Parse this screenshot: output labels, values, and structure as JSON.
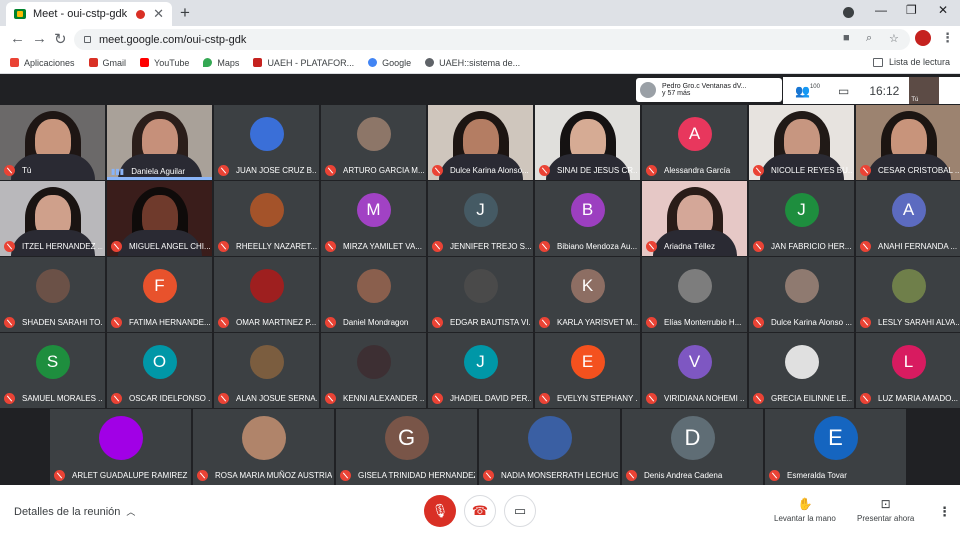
{
  "browser": {
    "tab_title": "Meet - oui-cstp-gdk",
    "tab_close": "✕",
    "new_tab": "+",
    "url": "meet.google.com/oui-cstp-gdk",
    "window_controls": [
      "—",
      "❐",
      "✕"
    ],
    "bookmarks": [
      {
        "label": "Aplicaciones",
        "color": "#ea4335"
      },
      {
        "label": "Gmail",
        "color": "#d93025"
      },
      {
        "label": "YouTube",
        "color": "#ff0000"
      },
      {
        "label": "Maps",
        "color": "#34a853"
      },
      {
        "label": "UAEH - PLATAFOR...",
        "color": "#c5221f"
      },
      {
        "label": "Google",
        "color": "#4285f4"
      },
      {
        "label": "UAEH::sistema de...",
        "color": "#5f6368"
      }
    ],
    "reading_list": "Lista de lectura"
  },
  "meet": {
    "presenter_line1": "Pedro Gro.c Ventanas dV...",
    "presenter_line2": "y 57 más",
    "people_count": "100",
    "clock": "16:12",
    "self_label": "Tú",
    "meeting_details": "Detalles de la reunión",
    "raise_hand": "Levantar la mano",
    "present_now": "Presentar ahora",
    "accent_color": "#8ab4f8",
    "mute_color": "#ea4335"
  },
  "participants": [
    {
      "name": "Tú",
      "kind": "video",
      "face": "#c9967d",
      "hair": "#1e1614",
      "bg": "#6b6969"
    },
    {
      "name": "Daniela Aguilar",
      "kind": "video",
      "face": "#c6907a",
      "hair": "#2b1e1a",
      "bg": "#a9a199",
      "speaking": true
    },
    {
      "name": "JUAN JOSE CRUZ B...",
      "kind": "photo",
      "color": "#3a6fd8"
    },
    {
      "name": "ARTURO GARCIA M...",
      "kind": "photo",
      "color": "#8d7668"
    },
    {
      "name": "Dulce Karina Alonso...",
      "kind": "video",
      "face": "#b47d63",
      "hair": "#1d1512",
      "bg": "#cfc6bd"
    },
    {
      "name": "SINAI DE JESUS CR...",
      "kind": "video",
      "face": "#d6ab94",
      "hair": "#151212",
      "bg": "#e0dfdc"
    },
    {
      "name": "Alessandra García",
      "kind": "letter",
      "letter": "A",
      "color": "#e8375d"
    },
    {
      "name": "NICOLLE REYES BU...",
      "kind": "video",
      "face": "#c79680",
      "hair": "#211a17",
      "bg": "#e7e3df"
    },
    {
      "name": "CESAR CRISTOBAL ...",
      "kind": "video",
      "face": "#c8947b",
      "hair": "#1c1512",
      "bg": "#9c8370"
    },
    {
      "name": "ITZEL HERNANDEZ ...",
      "kind": "video",
      "face": "#cfa08b",
      "hair": "#1a1412",
      "bg": "#b9b8bb"
    },
    {
      "name": "MIGUEL ANGEL CHI...",
      "kind": "video",
      "face": "#6f3a2c",
      "hair": "#0f0b0a",
      "bg": "#3a1d1b"
    },
    {
      "name": "RHEELLY NAZARET...",
      "kind": "photo",
      "color": "#a4532a"
    },
    {
      "name": "MIRZA YAMILET VA...",
      "kind": "letter",
      "letter": "M",
      "color": "#a142c4"
    },
    {
      "name": "JENNIFER TREJO S...",
      "kind": "letter",
      "letter": "J",
      "color": "#455a64"
    },
    {
      "name": "Bibiano Mendoza Au...",
      "kind": "letter",
      "letter": "B",
      "color": "#9c3fc0"
    },
    {
      "name": "Ariadna Téllez",
      "kind": "video",
      "face": "#d4a798",
      "hair": "#2a1c18",
      "bg": "#e6c8c6"
    },
    {
      "name": "JAN FABRICIO HER...",
      "kind": "letter",
      "letter": "J",
      "color": "#1e8e3e"
    },
    {
      "name": "ANAHI FERNANDA ...",
      "kind": "letter",
      "letter": "A",
      "color": "#5c6bc0"
    },
    {
      "name": "SHADEN SARAHI TO...",
      "kind": "photo",
      "color": "#6b5147"
    },
    {
      "name": "FATIMA HERNANDE...",
      "kind": "letter",
      "letter": "F",
      "color": "#e8522c"
    },
    {
      "name": "OMAR MARTINEZ P...",
      "kind": "photo",
      "color": "#9e1f1f"
    },
    {
      "name": "Daniel Mondragon",
      "kind": "photo",
      "color": "#8a5f4d"
    },
    {
      "name": "EDGAR BAUTISTA VI...",
      "kind": "photo",
      "color": "#4a4a4a"
    },
    {
      "name": "KARLA YARISVET M...",
      "kind": "letter",
      "letter": "K",
      "color": "#8d6e63"
    },
    {
      "name": "Elías Monterrubio H...",
      "kind": "photo",
      "color": "#7d7d7d"
    },
    {
      "name": "Dulce Karina Alonso ...",
      "kind": "photo",
      "color": "#8f7a70"
    },
    {
      "name": "LESLY SARAHI ALVA...",
      "kind": "photo",
      "color": "#6f7f4a"
    },
    {
      "name": "SAMUEL MORALES ...",
      "kind": "letter",
      "letter": "S",
      "color": "#1e8e3e"
    },
    {
      "name": "OSCAR IDELFONSO ...",
      "kind": "letter",
      "letter": "O",
      "color": "#0097a7"
    },
    {
      "name": "ALAN JOSUE SERNA...",
      "kind": "photo",
      "color": "#7b5d3f"
    },
    {
      "name": "KENNI ALEXANDER ...",
      "kind": "photo",
      "color": "#3d2f33"
    },
    {
      "name": "JHADIEL DAVID PER...",
      "kind": "letter",
      "letter": "J",
      "color": "#0097a7"
    },
    {
      "name": "EVELYN STEPHANY ...",
      "kind": "letter",
      "letter": "E",
      "color": "#f4511e"
    },
    {
      "name": "VIRIDIANA NOHEMI ...",
      "kind": "letter",
      "letter": "V",
      "color": "#7e57c2"
    },
    {
      "name": "GRECIA EILINNE LE...",
      "kind": "photo",
      "color": "#e0e0e0"
    },
    {
      "name": "LUZ MARIA AMADO...",
      "kind": "letter",
      "letter": "L",
      "color": "#d81b60"
    },
    {
      "name": "ARLET GUADALUPE RAMIREZ ...",
      "kind": "letter",
      "letter": "",
      "color": "#a100e6"
    },
    {
      "name": "ROSA MARIA MUÑOZ AUSTRIA",
      "kind": "photo",
      "color": "#b0846a"
    },
    {
      "name": "GISELA TRINIDAD HERNANDEZ",
      "kind": "letter",
      "letter": "G",
      "color": "#795548"
    },
    {
      "name": "NADIA MONSERRATH LECHUG...",
      "kind": "photo",
      "color": "#3a5fa3"
    },
    {
      "name": "Denis Andrea Cadena",
      "kind": "letter",
      "letter": "D",
      "color": "#5f6d75"
    },
    {
      "name": "Esmeralda Tovar",
      "kind": "letter",
      "letter": "E",
      "color": "#1565c0"
    }
  ]
}
